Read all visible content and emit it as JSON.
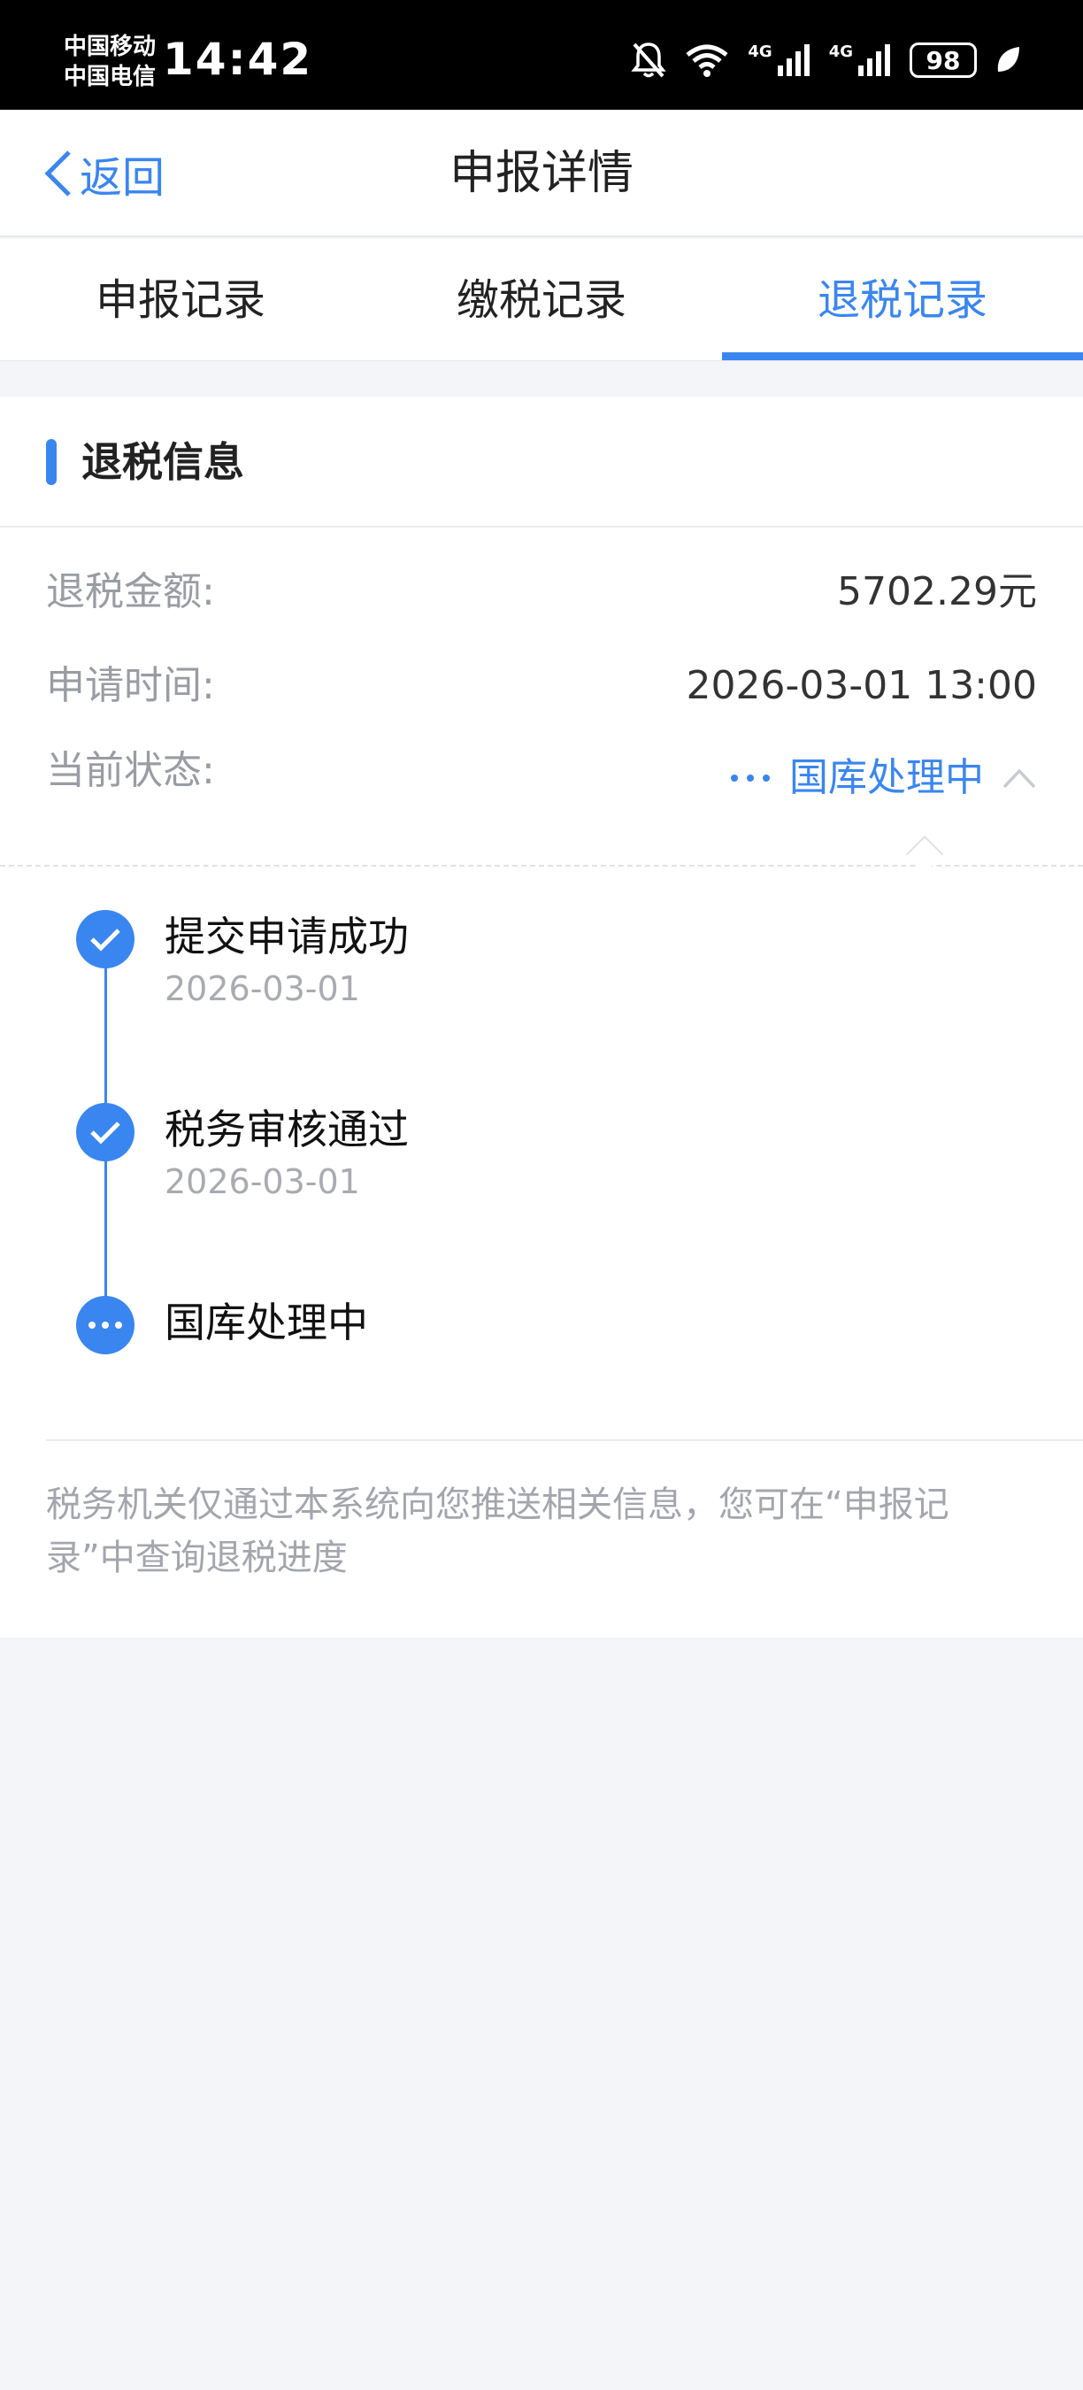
{
  "status_bar": {
    "carrier1": "中国移动",
    "carrier2": "中国电信",
    "time": "14:42",
    "net1": "4G",
    "net2": "4G",
    "battery": "98",
    "icons": [
      "mute-icon",
      "wifi-icon",
      "signal-icon",
      "signal-icon",
      "battery-icon",
      "leaf-icon"
    ]
  },
  "nav": {
    "back_label": "返回",
    "title": "申报详情"
  },
  "tabs": [
    {
      "label": "申报记录",
      "active": false
    },
    {
      "label": "缴税记录",
      "active": false
    },
    {
      "label": "退税记录",
      "active": true
    }
  ],
  "section": {
    "title": "退税信息"
  },
  "info": {
    "amount_label": "退税金额:",
    "amount_value": "5702.29元",
    "time_label": "申请时间:",
    "time_value": "2026-03-01 13:00",
    "status_label": "当前状态:",
    "status_value": "国库处理中"
  },
  "timeline": [
    {
      "title": "提交申请成功",
      "date": "2026-03-01",
      "state": "done"
    },
    {
      "title": "税务审核通过",
      "date": "2026-03-01",
      "state": "done"
    },
    {
      "title": "国库处理中",
      "date": "",
      "state": "processing"
    }
  ],
  "notice": "税务机关仅通过本系统向您推送相关信息，您可在“申报记录”中查询退税进度",
  "colors": {
    "accent": "#3a86f0",
    "background": "#f3f5f9"
  }
}
